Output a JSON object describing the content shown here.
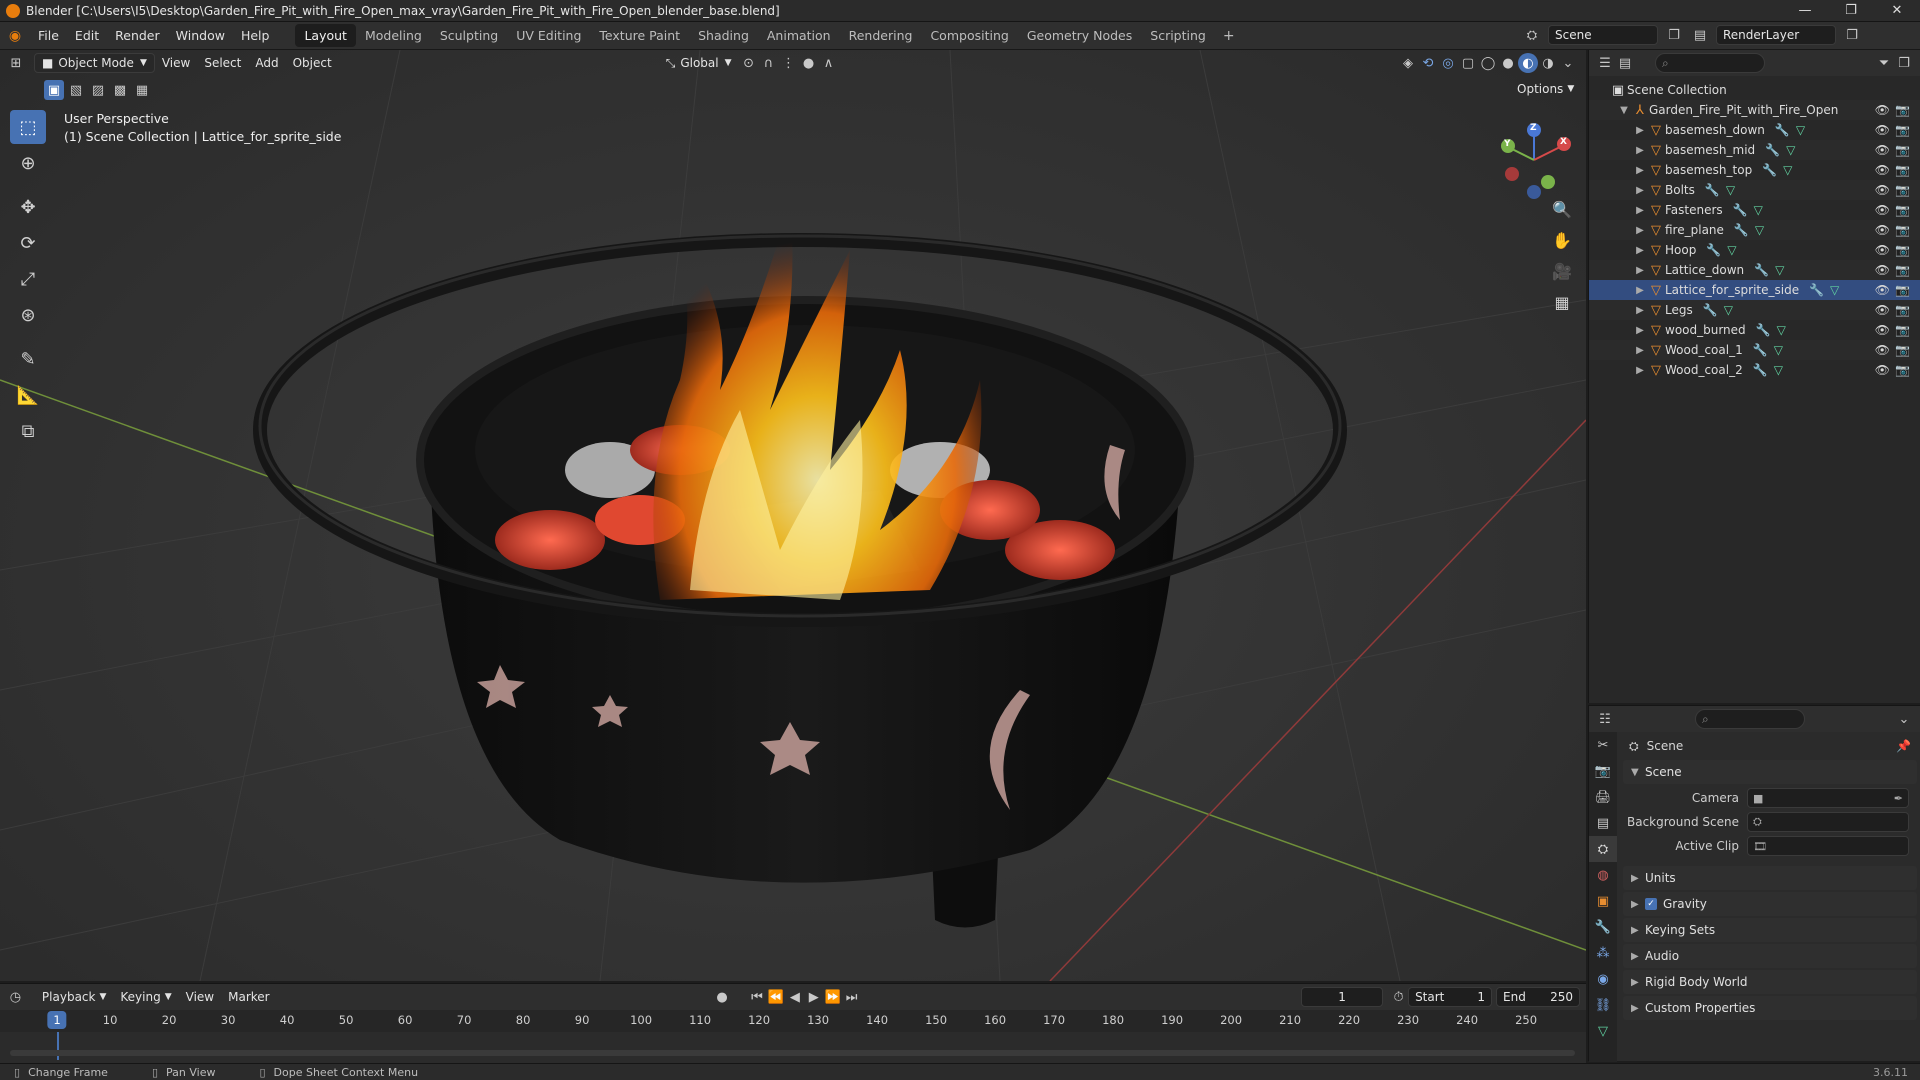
{
  "window": {
    "title": "Blender [C:\\Users\\I5\\Desktop\\Garden_Fire_Pit_with_Fire_Open_max_vray\\Garden_Fire_Pit_with_Fire_Open_blender_base.blend]",
    "minimize": "—",
    "maximize": "❐",
    "close": "✕"
  },
  "menu": [
    "File",
    "Edit",
    "Render",
    "Window",
    "Help"
  ],
  "workspaces": [
    "Layout",
    "Modeling",
    "Sculpting",
    "UV Editing",
    "Texture Paint",
    "Shading",
    "Animation",
    "Rendering",
    "Compositing",
    "Geometry Nodes",
    "Scripting"
  ],
  "active_workspace": "Layout",
  "scene_selector": "Scene",
  "view_layer": "RenderLayer",
  "viewport": {
    "mode": "Object Mode",
    "menus": [
      "View",
      "Select",
      "Add",
      "Object"
    ],
    "transform_orientation": "Global",
    "options": "Options",
    "perspective_label": "User Perspective",
    "collection_label": "(1) Scene Collection | Lattice_for_sprite_side",
    "gizmo_axes": {
      "x": "X",
      "y": "Y",
      "z": "Z"
    }
  },
  "outliner": {
    "root": "Scene Collection",
    "collection": "Garden_Fire_Pit_with_Fire_Open",
    "objects": [
      "basemesh_down",
      "basemesh_mid",
      "basemesh_top",
      "Bolts",
      "Fasteners",
      "fire_plane",
      "Hoop",
      "Lattice_down",
      "Lattice_for_sprite_side",
      "Legs",
      "wood_burned",
      "Wood_coal_1",
      "Wood_coal_2"
    ],
    "selected": "Lattice_for_sprite_side"
  },
  "properties": {
    "context": "Scene",
    "panel": "Scene",
    "fields": [
      {
        "label": "Camera"
      },
      {
        "label": "Background Scene"
      },
      {
        "label": "Active Clip"
      }
    ],
    "collapsed_panels": [
      "Units",
      "Gravity",
      "Keying Sets",
      "Audio",
      "Rigid Body World",
      "Custom Properties"
    ],
    "gravity_checked": true
  },
  "timeline": {
    "menus": [
      "Playback",
      "Keying",
      "View",
      "Marker"
    ],
    "current_frame": "1",
    "start_label": "Start",
    "start": "1",
    "end_label": "End",
    "end": "250",
    "ticks": [
      "10",
      "20",
      "30",
      "40",
      "50",
      "60",
      "70",
      "80",
      "90",
      "100",
      "110",
      "120",
      "130",
      "140",
      "150",
      "160",
      "170",
      "180",
      "190",
      "200",
      "210",
      "220",
      "230",
      "240",
      "250"
    ],
    "cursor_label": "1"
  },
  "statusbar": {
    "items": [
      "Change Frame",
      "Pan View",
      "Dope Sheet Context Menu"
    ],
    "version": "3.6.11"
  },
  "colors": {
    "accent": "#4772b3",
    "blender_orange": "#e87d0d",
    "selected_row": "#334d80"
  }
}
